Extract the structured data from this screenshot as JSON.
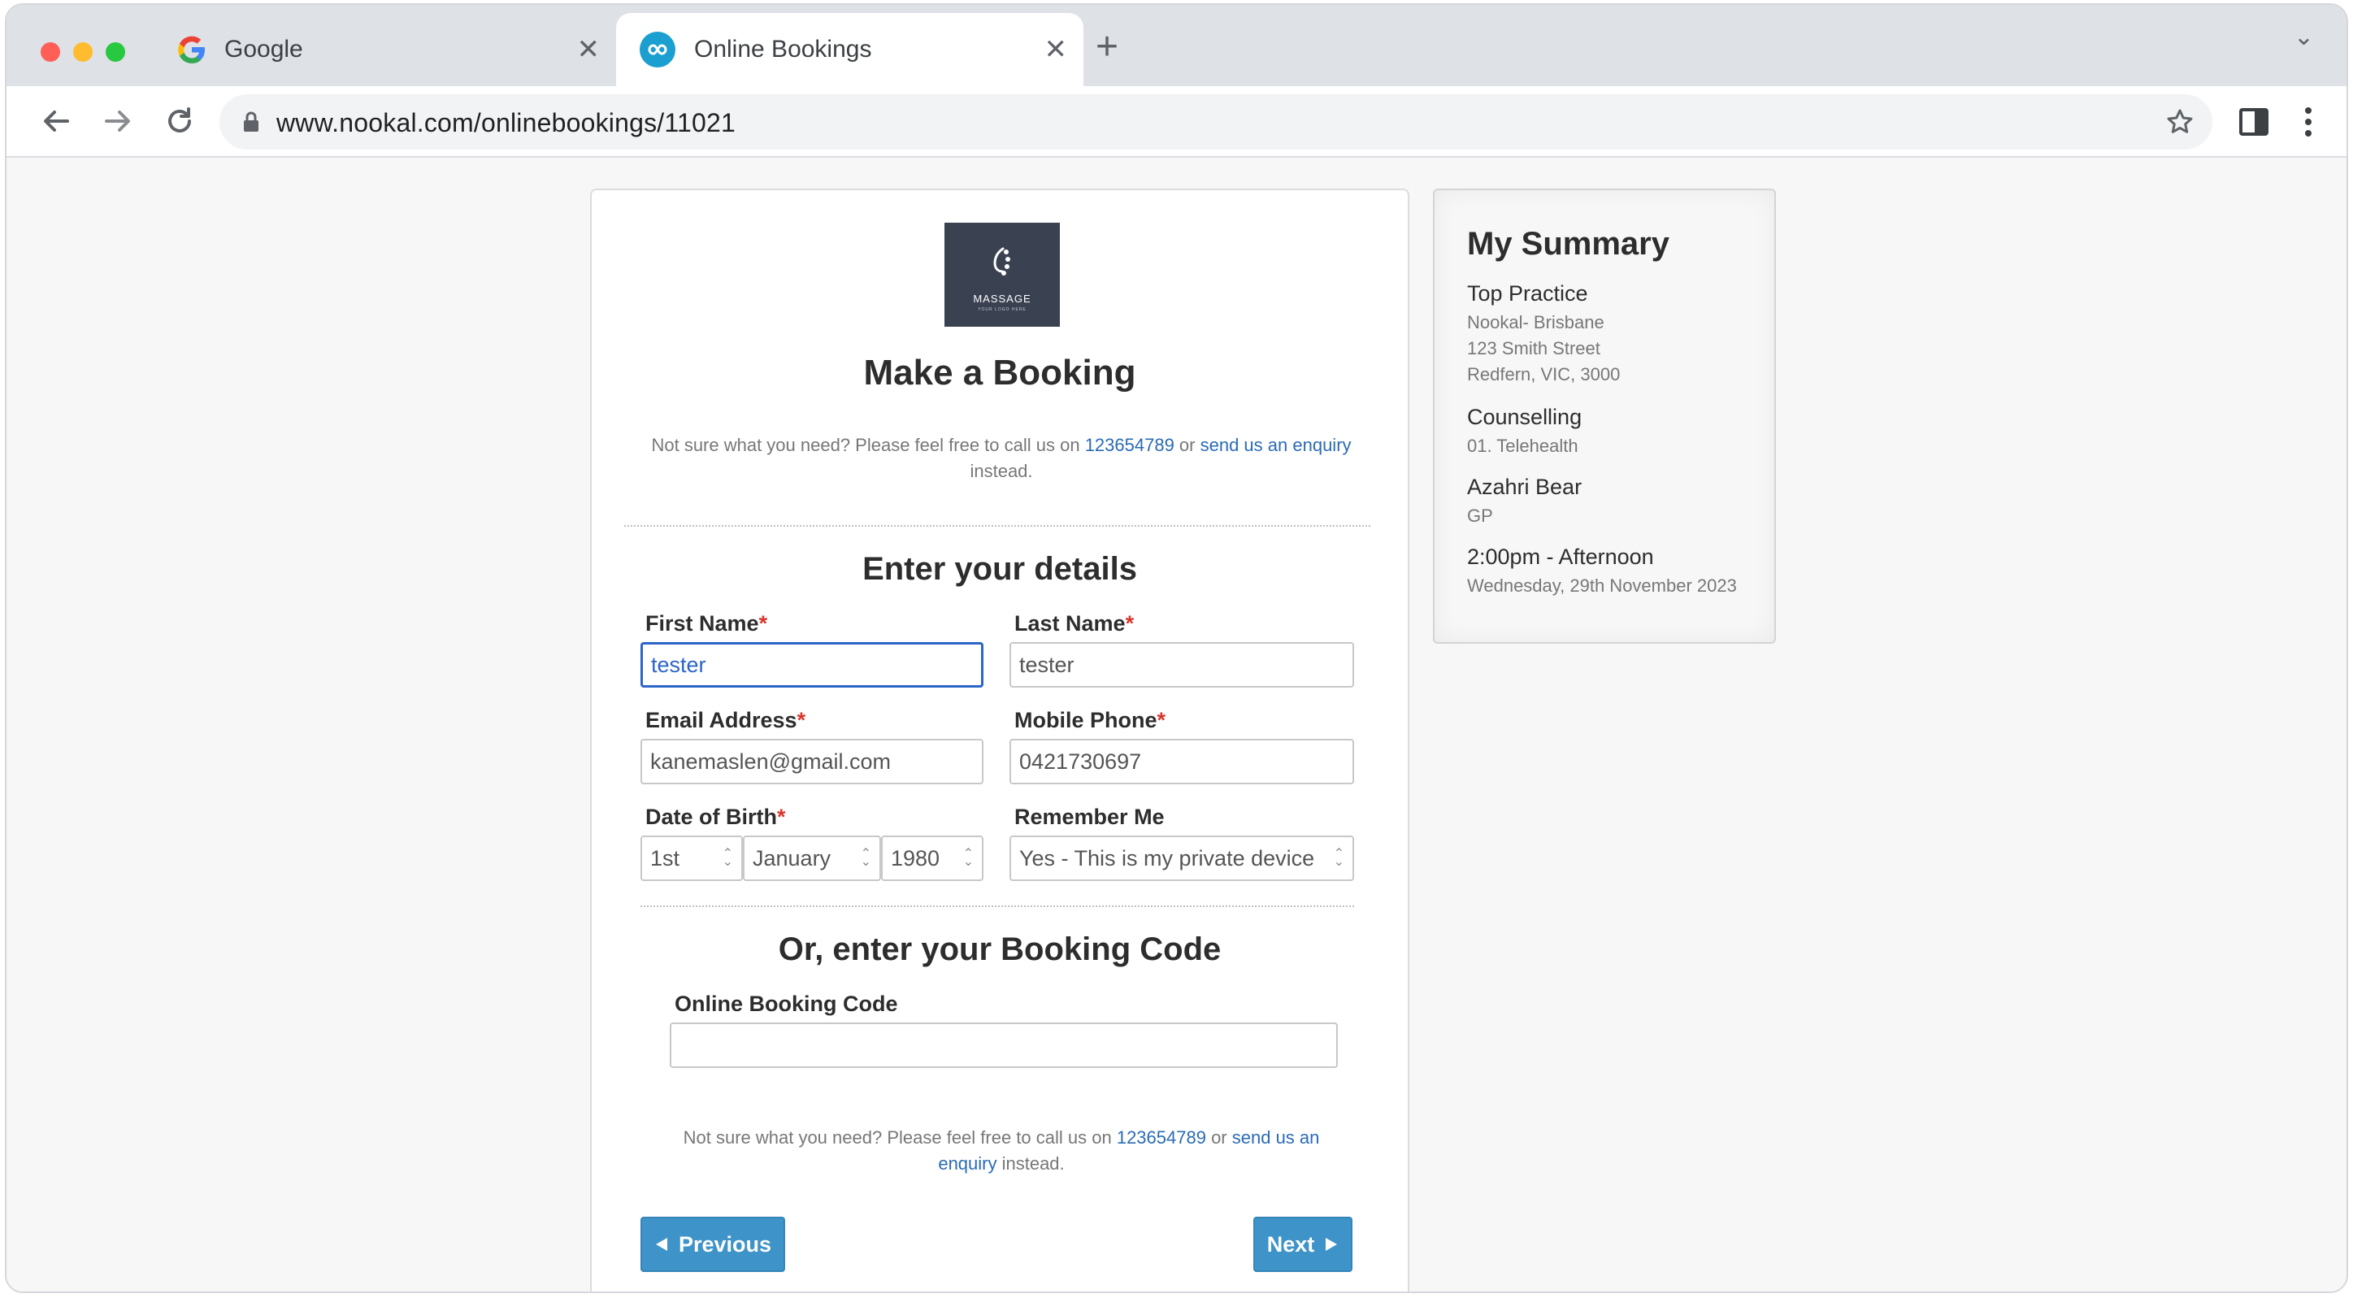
{
  "browser": {
    "tabs": [
      {
        "title": "Google",
        "active": false,
        "icon": "google-icon"
      },
      {
        "title": "Online Bookings",
        "active": true,
        "icon": "nookal-infinity-icon"
      }
    ],
    "url": "www.nookal.com/onlinebookings/11021",
    "colors": {
      "close": "#ff5f57",
      "minimize": "#febc2e",
      "zoom": "#28c840"
    }
  },
  "logo": {
    "brand": "MASSAGE",
    "tagline": "YOUR LOGO HERE"
  },
  "booking": {
    "title": "Make a Booking",
    "help_top": {
      "prefix": "Not sure what you need? Please feel free to call us on ",
      "phone": "123654789",
      "or": " or ",
      "link": "send us an enquiry",
      "suffix": "instead."
    },
    "details_heading": "Enter your details",
    "fields": {
      "first_name": {
        "label": "First Name",
        "value": "tester"
      },
      "last_name": {
        "label": "Last Name",
        "value": "tester"
      },
      "email": {
        "label": "Email Address",
        "value": "kanemaslen@gmail.com"
      },
      "mobile": {
        "label": "Mobile Phone",
        "value": "0421730697"
      },
      "dob": {
        "label": "Date of Birth",
        "day": "1st",
        "month": "January",
        "year": "1980"
      },
      "remember": {
        "label": "Remember Me",
        "value": "Yes - This is my private device"
      }
    },
    "required_mark": "*",
    "code_heading": "Or, enter your Booking Code",
    "code_label": "Online Booking Code",
    "code_value": "",
    "help_bottom": {
      "prefix": "Not sure what you need? Please feel free to call us on ",
      "phone": "123654789",
      "or": " or ",
      "link_a": "send us an",
      "link_b": "enquiry",
      "suffix": " instead."
    },
    "prev_label": "Previous",
    "next_label": "Next",
    "button_color": "#3e93c8"
  },
  "summary": {
    "title": "My Summary",
    "practice": "Top Practice",
    "location": "Nookal- Brisbane",
    "street": "123 Smith Street",
    "suburb": "Redfern, VIC, 3000",
    "service": "Counselling",
    "service_detail": "01. Telehealth",
    "practitioner": "Azahri Bear",
    "practitioner_role": "GP",
    "time": "2:00pm - Afternoon",
    "date": "Wednesday, 29th November 2023"
  }
}
